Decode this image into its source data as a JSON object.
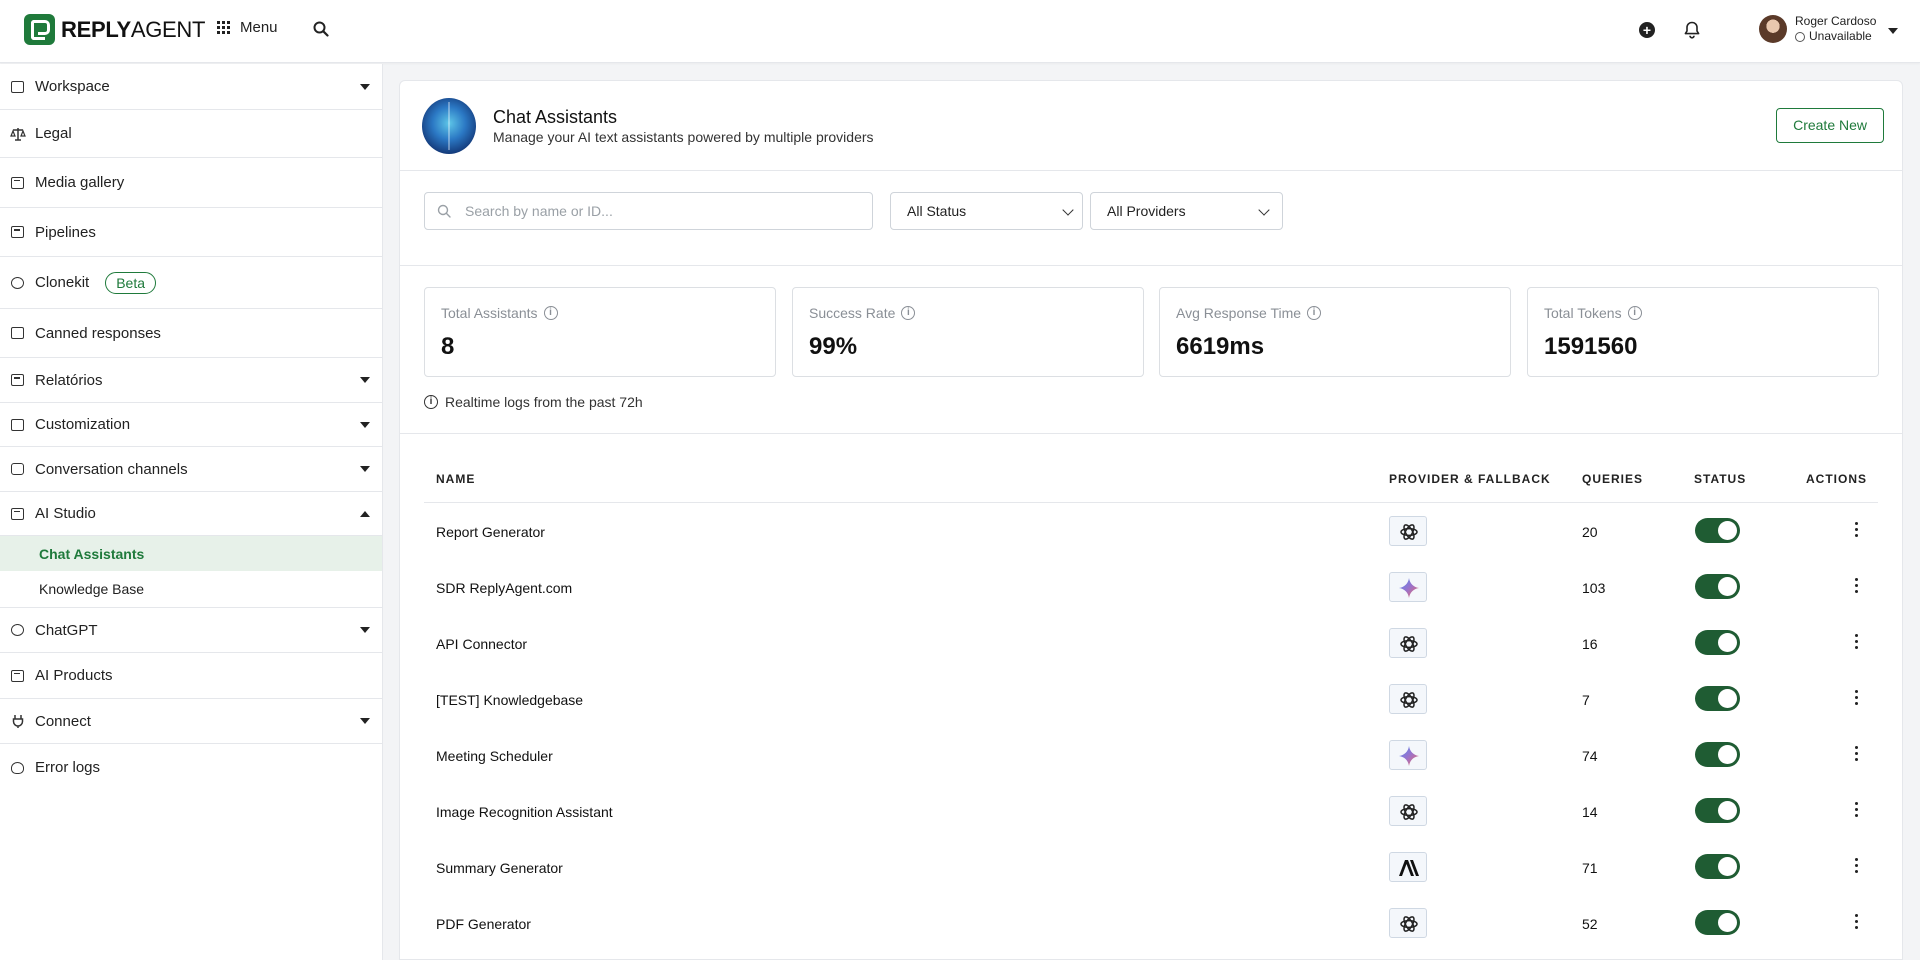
{
  "app": {
    "logo_bold": "REPLY",
    "logo_light": "AGENT",
    "menu_label": "Menu"
  },
  "user": {
    "name": "Roger Cardoso",
    "status": "Unavailable"
  },
  "sidebar": {
    "items": [
      {
        "label": "Workspace",
        "icon": "workspace-icon",
        "caret": "down"
      },
      {
        "label": "Legal",
        "icon": "scale-icon"
      },
      {
        "label": "Media gallery",
        "icon": "media-icon"
      },
      {
        "label": "Pipelines",
        "icon": "pipeline-icon"
      },
      {
        "label": "Clonekit",
        "icon": "clone-icon",
        "badge": "Beta"
      },
      {
        "label": "Canned responses",
        "icon": "folder-icon"
      },
      {
        "label": "Relatórios",
        "icon": "report-icon",
        "caret": "down"
      },
      {
        "label": "Customization",
        "icon": "customization-icon",
        "caret": "down"
      },
      {
        "label": "Conversation channels",
        "icon": "chat-icon",
        "caret": "down"
      },
      {
        "label": "AI Studio",
        "icon": "chip-icon",
        "caret": "up"
      },
      {
        "label": "ChatGPT",
        "icon": "openai-icon",
        "caret": "down"
      },
      {
        "label": "AI Products",
        "icon": "chip-icon"
      },
      {
        "label": "Connect",
        "icon": "plug-icon",
        "caret": "down"
      },
      {
        "label": "Error logs",
        "icon": "bug-icon"
      }
    ],
    "ai_studio_sub": [
      {
        "label": "Chat Assistants",
        "active": true
      },
      {
        "label": "Knowledge Base",
        "active": false
      }
    ]
  },
  "page": {
    "title": "Chat Assistants",
    "subtitle": "Manage your AI text assistants powered by multiple providers",
    "create_button": "Create New"
  },
  "filters": {
    "search_placeholder": "Search by name or ID...",
    "status_selected": "All Status",
    "provider_selected": "All Providers"
  },
  "stats": [
    {
      "label": "Total Assistants",
      "value": "8"
    },
    {
      "label": "Success Rate",
      "value": "99%"
    },
    {
      "label": "Avg Response Time",
      "value": "6619ms"
    },
    {
      "label": "Total Tokens",
      "value": "1591560"
    }
  ],
  "realtime_note": "Realtime logs from the past 72h",
  "table": {
    "headers": {
      "name": "NAME",
      "provider": "PROVIDER & FALLBACK",
      "queries": "QUERIES",
      "status": "STATUS",
      "actions": "ACTIONS"
    },
    "rows": [
      {
        "name": "Report Generator",
        "provider": "openai",
        "queries": "20",
        "status": "on"
      },
      {
        "name": "SDR ReplyAgent.com",
        "provider": "gemini",
        "queries": "103",
        "status": "on"
      },
      {
        "name": "API Connector",
        "provider": "openai",
        "queries": "16",
        "status": "on"
      },
      {
        "name": "[TEST] Knowledgebase",
        "provider": "openai",
        "queries": "7",
        "status": "on"
      },
      {
        "name": "Meeting Scheduler",
        "provider": "gemini",
        "queries": "74",
        "status": "on"
      },
      {
        "name": "Image Recognition Assistant",
        "provider": "openai",
        "queries": "14",
        "status": "on"
      },
      {
        "name": "Summary Generator",
        "provider": "anthropic",
        "queries": "71",
        "status": "on"
      },
      {
        "name": "PDF Generator",
        "provider": "openai",
        "queries": "52",
        "status": "on"
      }
    ]
  },
  "colors": {
    "brand": "#1f7a3b",
    "toggle_on": "#1f5c33",
    "active_bg": "#e7f1e9"
  }
}
